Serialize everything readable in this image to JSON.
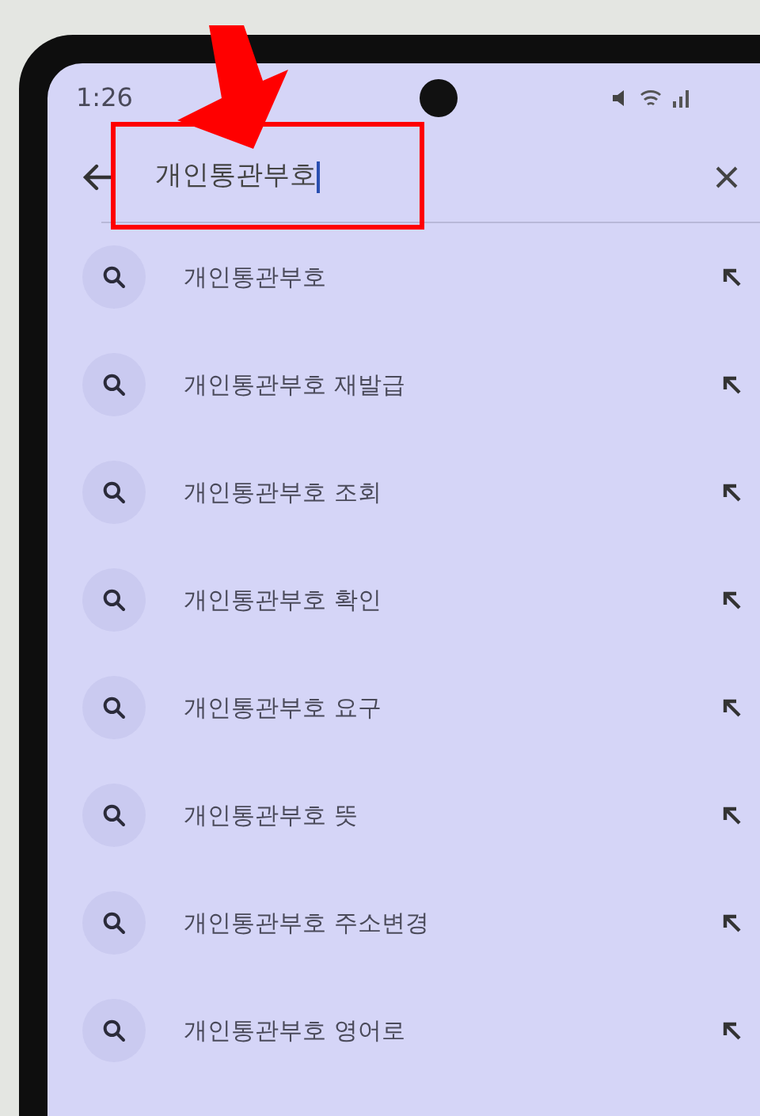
{
  "status_bar": {
    "time": "1:26"
  },
  "search": {
    "value": "개인통관부호"
  },
  "suggestions": [
    {
      "text": "개인통관부호"
    },
    {
      "text": "개인통관부호 재발급"
    },
    {
      "text": "개인통관부호 조회"
    },
    {
      "text": "개인통관부호 확인"
    },
    {
      "text": "개인통관부호 요구"
    },
    {
      "text": "개인통관부호 뜻"
    },
    {
      "text": "개인통관부호 주소변경"
    },
    {
      "text": "개인통관부호 영어로"
    }
  ]
}
